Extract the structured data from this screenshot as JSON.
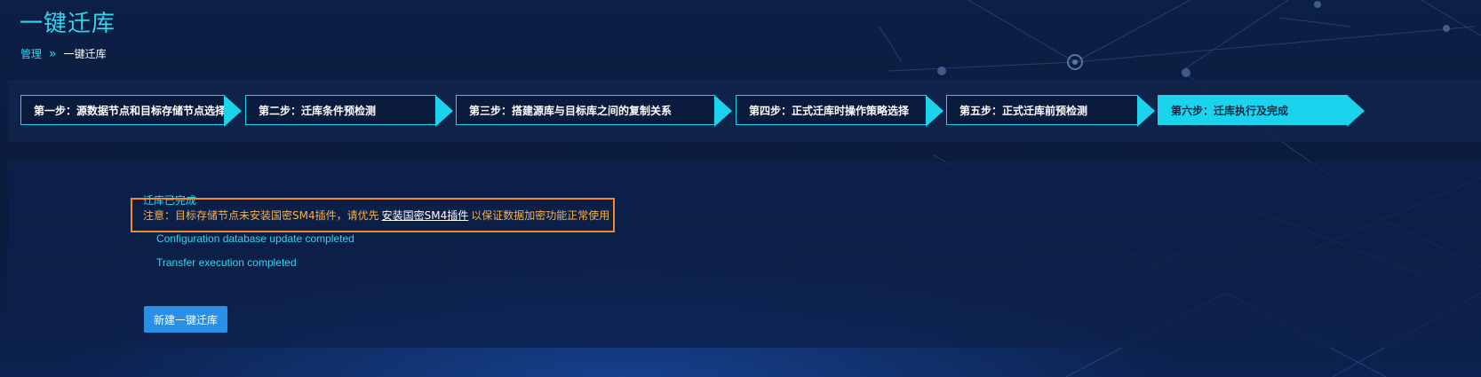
{
  "page": {
    "title": "一键迁库"
  },
  "breadcrumb": {
    "parent": "管理",
    "separator": "»",
    "current": "一键迁库"
  },
  "steps": [
    {
      "label": "第一步：源数据节点和目标存储节点选择",
      "active": false
    },
    {
      "label": "第二步：迁库条件预检测",
      "active": false
    },
    {
      "label": "第三步：搭建源库与目标库之间的复制关系",
      "active": false
    },
    {
      "label": "第四步：正式迁库时操作策略选择",
      "active": false
    },
    {
      "label": "第五步：正式迁库前预检测",
      "active": false
    },
    {
      "label": "第六步：迁库执行及完成",
      "active": true
    }
  ],
  "result": {
    "status_title": "迁库已完成",
    "notice_prefix": "注意：目标存储节点未安装国密SM4插件，请优先",
    "notice_link": "安装国密SM4插件",
    "notice_suffix": "以保证数据加密功能正常使用",
    "logs": [
      "Configuration database update completed",
      "Transfer execution completed"
    ]
  },
  "actions": {
    "new_label": "新建一键迁库"
  },
  "colors": {
    "accent": "#1bd3ec",
    "warning": "#f08a2c",
    "button": "#2a8fe6"
  }
}
